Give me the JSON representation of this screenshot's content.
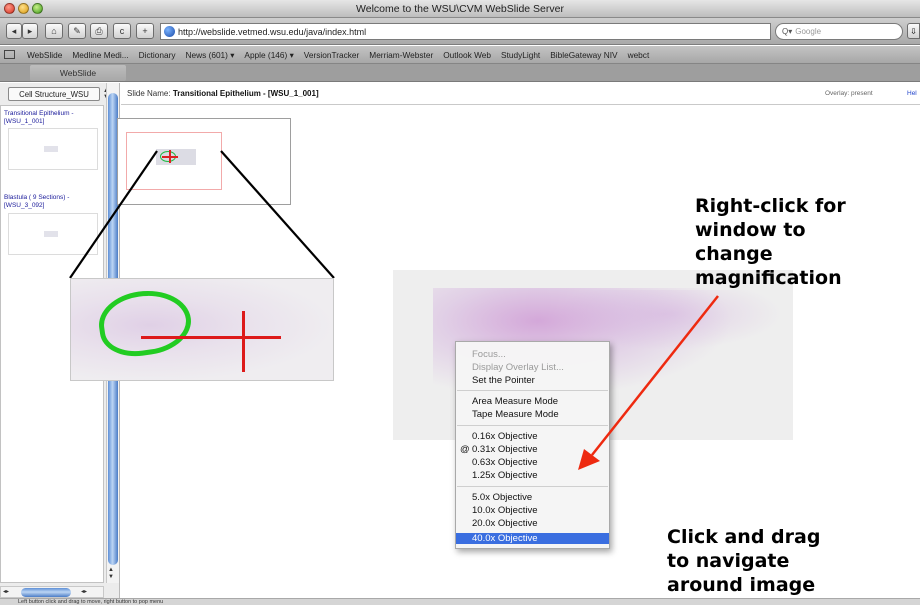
{
  "window": {
    "title": "Welcome to the WSU\\CVM WebSlide Server"
  },
  "toolbar": {
    "back_icon": "◂",
    "forward_icon": "▸",
    "home_icon": "⌂",
    "edit_icon": "✎",
    "print_icon": "⎙",
    "reload_icon": "c",
    "add_icon": "+",
    "url": "http://webslide.vetmed.wsu.edu/java/index.html",
    "search_placeholder": "Google",
    "url_menu_icon": "^",
    "search_icon": "Q▾"
  },
  "bookmarks": {
    "items": [
      "WebSlide",
      "Medline Medi...",
      "Dictionary",
      "News (601) ▾",
      "Apple (146) ▾",
      "VersionTracker",
      "Merriam-Webster",
      "Outlook Web",
      "StudyLight",
      "BibleGateway NIV",
      "webct"
    ]
  },
  "tabs": [
    {
      "label": "WebSlide"
    }
  ],
  "left_panel": {
    "dropdown": "Cell Structure_WSU",
    "slides": [
      {
        "label": "Transitional Epithelium - [WSU_1_001]"
      },
      {
        "label": "Blastula ( 9 Sections) - [WSU_3_092]"
      }
    ]
  },
  "slide_bar": {
    "prefix": "Slide Name:",
    "name": "Transitional Epithelium - [WSU_1_001]",
    "overlay_status": "Overlay: present",
    "help": "Hel"
  },
  "context_menu": {
    "items": [
      {
        "label": "Focus...",
        "enabled": false
      },
      {
        "label": "Display Overlay List...",
        "enabled": false
      },
      {
        "label": "Set the Pointer",
        "enabled": true
      },
      {
        "label": "Area Measure Mode",
        "enabled": true
      },
      {
        "label": "Tape Measure Mode",
        "enabled": true
      },
      {
        "label": "0.16x Objective",
        "enabled": true
      },
      {
        "label": "0.31x Objective",
        "enabled": true,
        "checked": true,
        "check_mark": "@"
      },
      {
        "label": "0.63x Objective",
        "enabled": true
      },
      {
        "label": "1.25x Objective",
        "enabled": true
      },
      {
        "label": "5.0x Objective",
        "enabled": true
      },
      {
        "label": "10.0x Objective",
        "enabled": true
      },
      {
        "label": "20.0x Objective",
        "enabled": true
      },
      {
        "label": "40.0x Objective",
        "enabled": true,
        "selected": true
      }
    ]
  },
  "annotations": {
    "right_click": [
      "Right-click for",
      "window to",
      "change",
      "magnification"
    ],
    "click_drag": [
      "Click and drag",
      "to navigate",
      "around image"
    ]
  },
  "status_bar": {
    "text": "Left button click and drag to move, right button to pop menu"
  },
  "colors": {
    "arrow": "#ee2a10",
    "selection": "#3a6ee0",
    "overlay_green": "#22cc22",
    "pointer_red": "#dd1a1a"
  }
}
